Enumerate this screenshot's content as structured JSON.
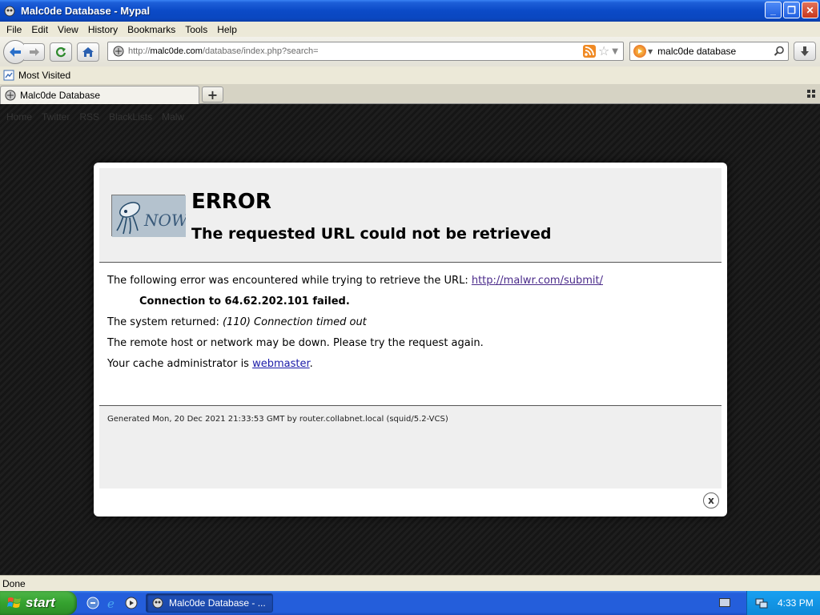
{
  "window": {
    "title": "Malc0de Database - Mypal",
    "buttons": {
      "minimize": "_",
      "maximize": "❐",
      "close": "✕"
    }
  },
  "menu": [
    "File",
    "Edit",
    "View",
    "History",
    "Bookmarks",
    "Tools",
    "Help"
  ],
  "navbar": {
    "url_prefix": "http://",
    "url_host": "malc0de.com",
    "url_path": "/database/index.php?search=",
    "search_value": "malc0de database"
  },
  "bookmarks": {
    "most_visited": "Most Visited"
  },
  "tabs": [
    {
      "label": "Malc0de Database"
    }
  ],
  "new_tab": "+",
  "background_nav": [
    "Home",
    "Twitter",
    "RSS",
    "BlackLists",
    "Malw"
  ],
  "error_page": {
    "title": "ERROR",
    "subtitle": "The requested URL could not be retrieved",
    "line1_text": "The following error was encountered while trying to retrieve the URL: ",
    "line1_link": "http://malwr.com/submit/",
    "line2": "Connection to 64.62.202.101 failed.",
    "line3_text": "The system returned: ",
    "line3_em": "(110) Connection timed out",
    "line4": "The remote host or network may be down. Please try the request again.",
    "line5_text": "Your cache administrator is ",
    "line5_link": "webmaster",
    "line5_end": ".",
    "logo_text": "NOW",
    "footer": "Generated Mon, 20 Dec 2021 21:33:53 GMT by router.collabnet.local (squid/5.2-VCS)",
    "close": "x"
  },
  "status": "Done",
  "taskbar": {
    "start": "start",
    "task_label": "Malc0de Database - ...",
    "clock": "4:33 PM"
  },
  "colors": {
    "titlebar": "#0b4ac7",
    "taskbar": "#245edb",
    "start_green": "#35a22f",
    "visited_link": "#4a2a8a"
  }
}
